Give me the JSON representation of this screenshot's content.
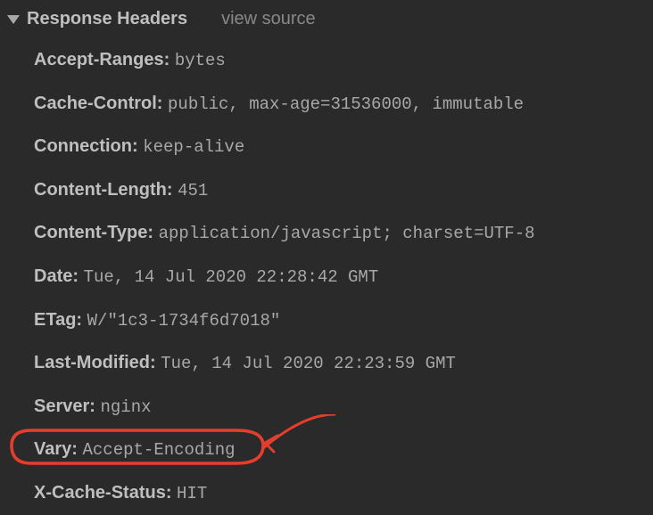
{
  "section": {
    "title": "Response Headers",
    "view_source": "view source"
  },
  "headers": [
    {
      "name": "Accept-Ranges:",
      "value": "bytes"
    },
    {
      "name": "Cache-Control:",
      "value": "public, max-age=31536000, immutable"
    },
    {
      "name": "Connection:",
      "value": "keep-alive"
    },
    {
      "name": "Content-Length:",
      "value": "451"
    },
    {
      "name": "Content-Type:",
      "value": "application/javascript; charset=UTF-8"
    },
    {
      "name": "Date:",
      "value": "Tue, 14 Jul 2020 22:28:42 GMT"
    },
    {
      "name": "ETag:",
      "value": "W/\"1c3-1734f6d7018\""
    },
    {
      "name": "Last-Modified:",
      "value": "Tue, 14 Jul 2020 22:23:59 GMT"
    },
    {
      "name": "Server:",
      "value": "nginx"
    },
    {
      "name": "Vary:",
      "value": "Accept-Encoding"
    },
    {
      "name": "X-Cache-Status:",
      "value": "HIT"
    }
  ]
}
